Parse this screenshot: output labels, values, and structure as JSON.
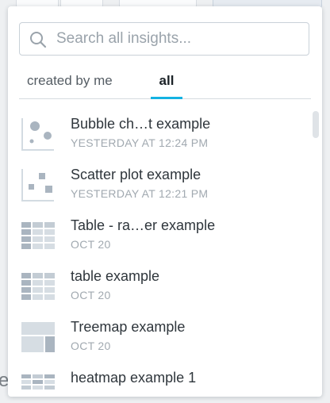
{
  "search": {
    "placeholder": "Search all insights..."
  },
  "tabs": [
    {
      "label": "created by me",
      "active": false
    },
    {
      "label": "all",
      "active": true
    }
  ],
  "accent_color": "#14b2e2",
  "insights": [
    {
      "title": "Bubble ch…t example",
      "date": "YESTERDAY AT 12:24 PM",
      "icon": "bubble-chart-icon"
    },
    {
      "title": "Scatter plot example",
      "date": "YESTERDAY AT 12:21 PM",
      "icon": "scatter-plot-icon"
    },
    {
      "title": "Table - ra…er example",
      "date": "OCT 20",
      "icon": "table-icon"
    },
    {
      "title": "table example",
      "date": "OCT 20",
      "icon": "table-icon"
    },
    {
      "title": "Treemap example",
      "date": "OCT 20",
      "icon": "treemap-icon"
    },
    {
      "title": "heatmap example 1",
      "date": "",
      "icon": "heatmap-icon"
    }
  ]
}
